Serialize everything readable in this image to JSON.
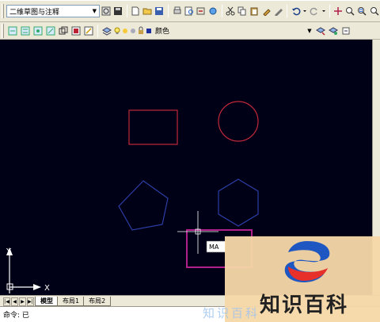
{
  "toolbar1": {
    "workspace": "二维草图与注释"
  },
  "toolbar2": {
    "layer_color": "颜色"
  },
  "canvas": {
    "tooltip": "MA",
    "axis_x": "X",
    "axis_y": "Y"
  },
  "tabs": {
    "model": "模型",
    "layout1": "布局1",
    "layout2": "布局2"
  },
  "command": {
    "prompt": "命令: 已"
  },
  "watermark": {
    "text": "知识百科",
    "faded": "知识百科"
  },
  "colors": {
    "canvas": "#000016",
    "rect_red": "#c0283a",
    "circle_red": "#c0283a",
    "pentagon_blue": "#2c3ea6",
    "hexagon_blue": "#2c3ea6",
    "selected_magenta": "#b0208c",
    "cursor": "#ffffff"
  }
}
